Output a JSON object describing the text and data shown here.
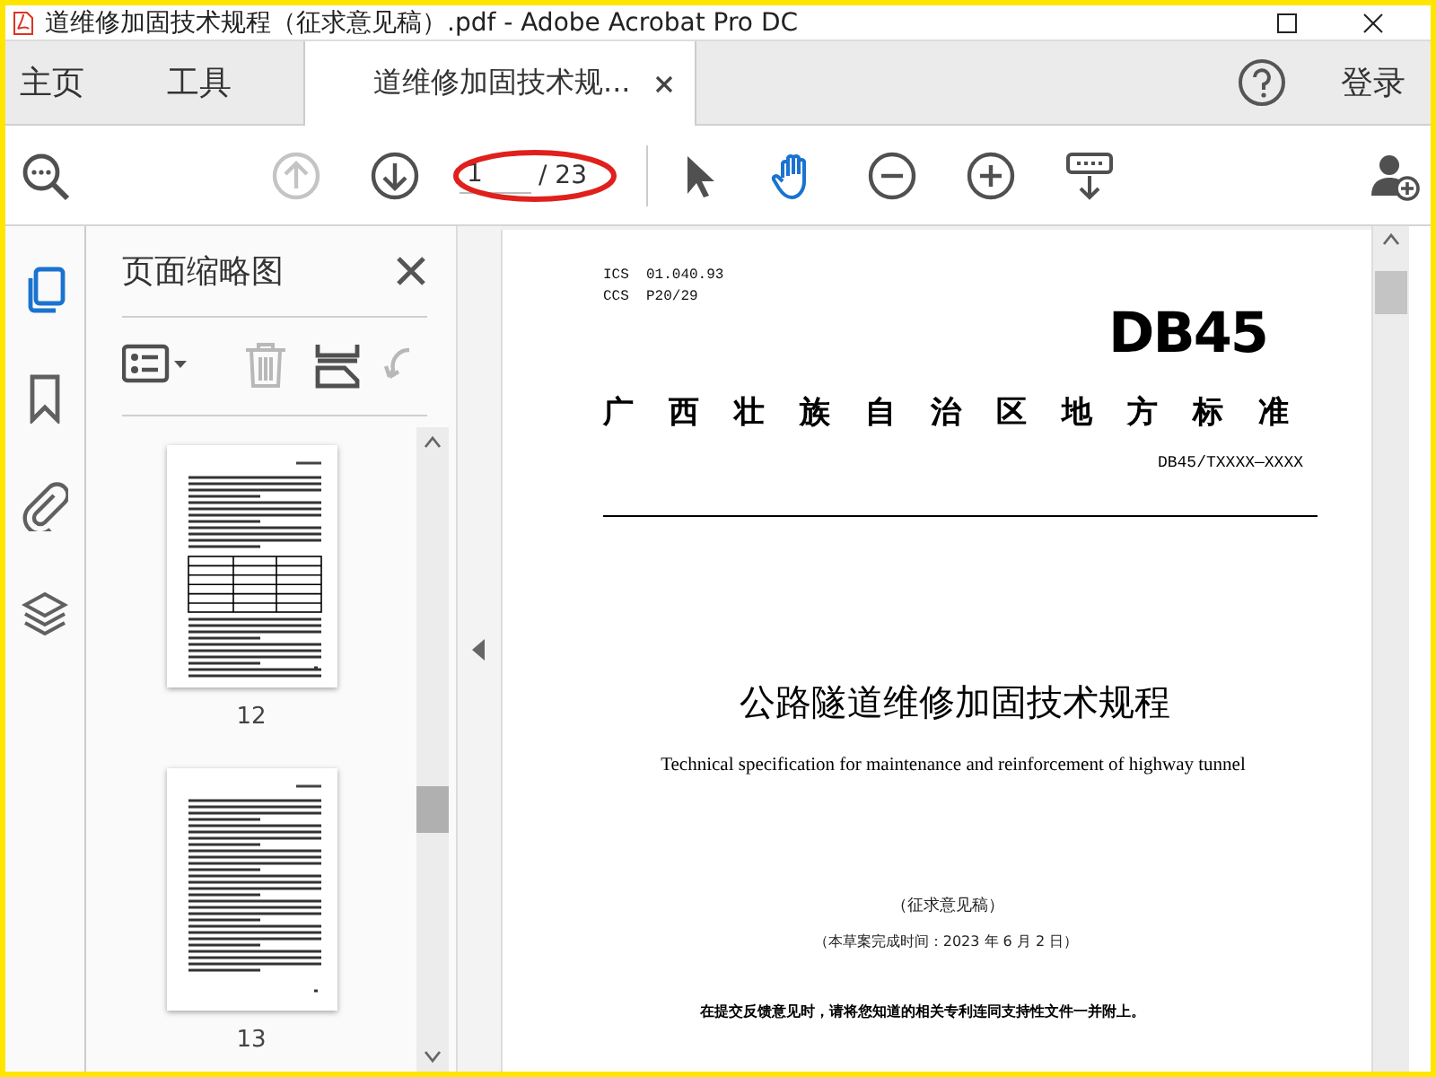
{
  "window": {
    "title": "道维修加固技术规程（征求意见稿）.pdf - Adobe Acrobat Pro DC"
  },
  "nav_tabs": [
    {
      "label": "主页",
      "selected": false
    },
    {
      "label": "工具",
      "selected": false
    },
    {
      "label": "道维修加固技术规...",
      "selected": true
    }
  ],
  "sign_in": "登录",
  "toolbar": {
    "tools": [
      {
        "kind": "search"
      },
      {
        "kind": "prev",
        "disabled": true
      },
      {
        "kind": "next",
        "disabled": false
      },
      {
        "kind": "page"
      },
      {
        "kind": "pointer",
        "selected": false
      },
      {
        "kind": "hand",
        "selected": true
      },
      {
        "kind": "zoom-out"
      },
      {
        "kind": "zoom-in"
      },
      {
        "kind": "keyboard"
      },
      {
        "kind": "share"
      }
    ],
    "page_value": "1",
    "page_total": "/ 23",
    "annotation": {
      "kind": "ellipse",
      "color": "#e0201c"
    }
  },
  "sidebar": {
    "items": [
      {
        "kind": "pages",
        "selected": true
      },
      {
        "kind": "bookmark",
        "selected": false
      },
      {
        "kind": "attachment",
        "selected": false
      },
      {
        "kind": "layers",
        "selected": false
      }
    ]
  },
  "thumbnails_panel": {
    "title": "页面缩略图",
    "tools": [
      {
        "kind": "options",
        "disabled": false
      },
      {
        "kind": "delete",
        "disabled": true
      },
      {
        "kind": "insert",
        "disabled": false
      },
      {
        "kind": "rotate",
        "disabled": true
      }
    ],
    "pages": [
      {
        "label": "12",
        "kind": "table"
      },
      {
        "label": "13",
        "kind": "text"
      }
    ]
  },
  "document": {
    "ics": "ICS  01.040.93",
    "ccs": "CCS  P20/29",
    "logo": "DB45",
    "heading": "广西壮族自治区地方标准",
    "number": "DB45/TXXXX—XXXX",
    "title": "公路隧道维修加固技术规程",
    "english_title": "Technical specification for maintenance and reinforcement of highway tunnel",
    "draft": "（征求意见稿）",
    "completion": "（本草案完成时间：2023 年 6 月 2 日）",
    "notice": "在提交反馈意见时，请将您知道的相关专利连同支持性文件一并附上。"
  }
}
